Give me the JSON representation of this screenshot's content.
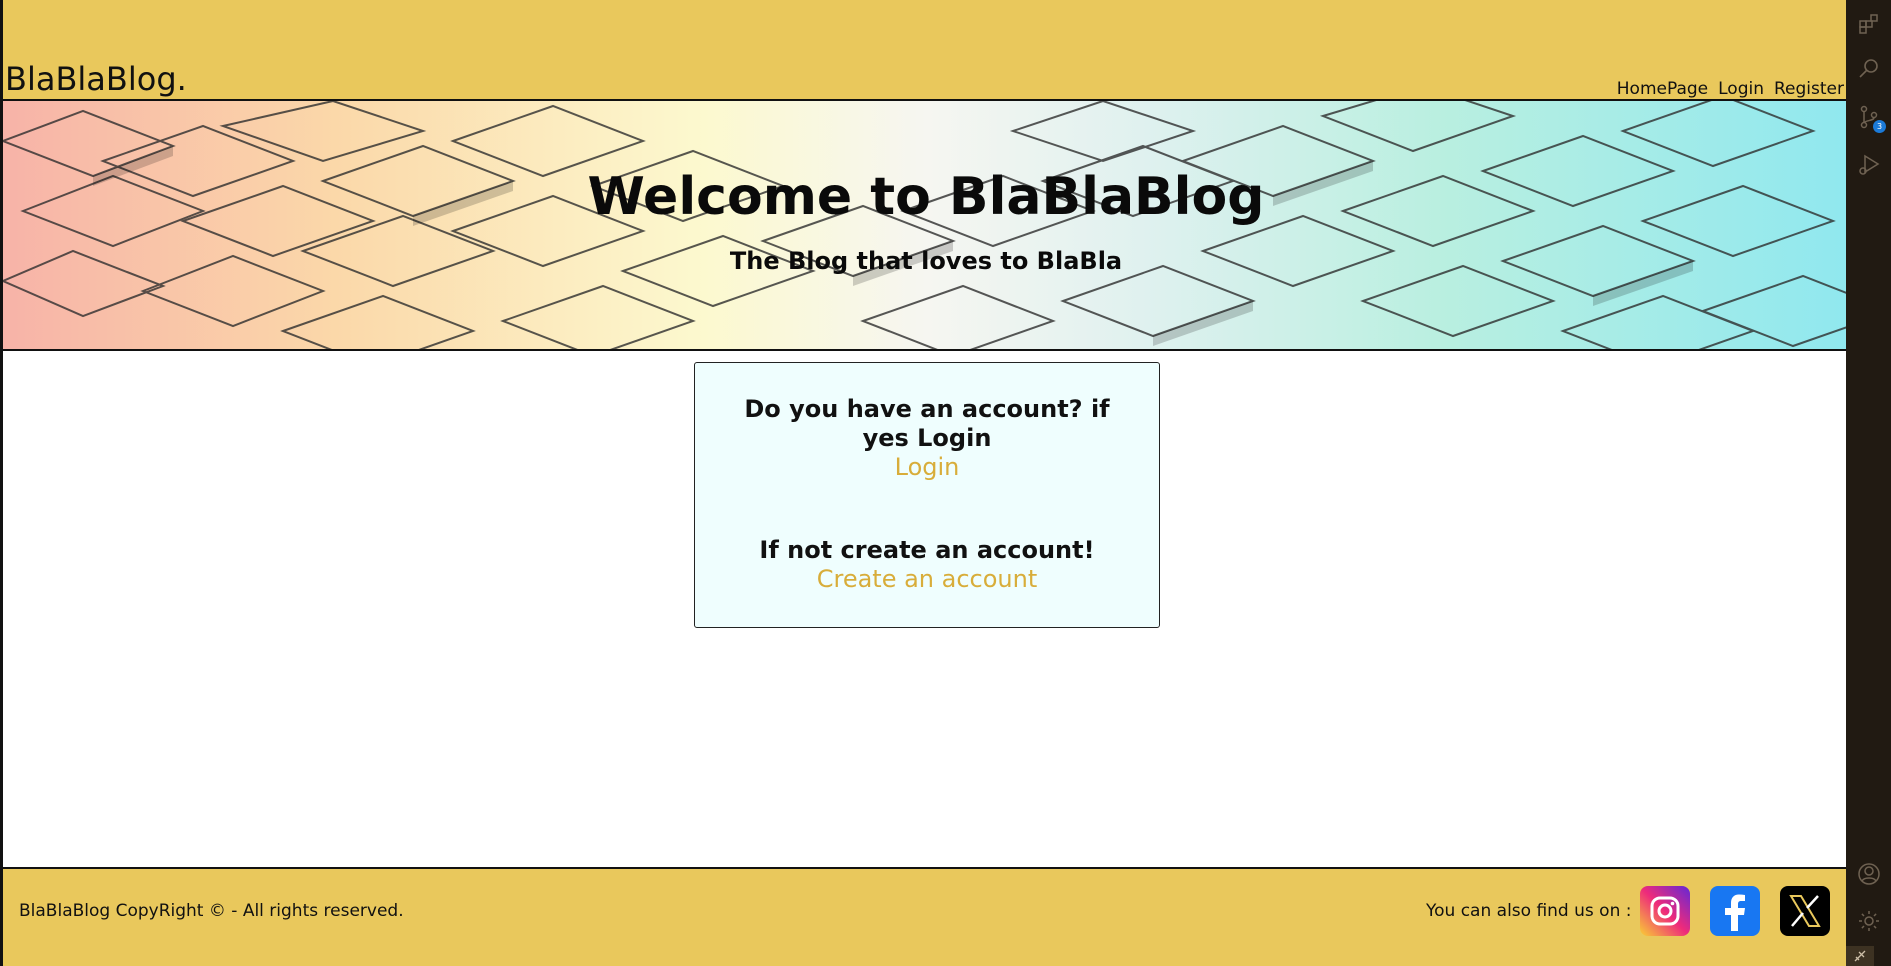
{
  "header": {
    "brand": "BlaBlaBlog.",
    "nav": [
      {
        "label": "HomePage"
      },
      {
        "label": "Login"
      },
      {
        "label": "Register"
      }
    ]
  },
  "hero": {
    "title": "Welcome to BlaBlaBlog",
    "subtitle": "The Blog that loves to BlaBla"
  },
  "card": {
    "login_question": "Do you have an account? if yes Login",
    "login_link": "Login",
    "register_question": "If not create an account!",
    "register_link": "Create an account"
  },
  "footer": {
    "copyright": "BlaBlaBlog CopyRight © - All rights reserved.",
    "find_us": "You can also find us on :",
    "social": [
      "instagram-icon",
      "facebook-icon",
      "x-icon"
    ]
  },
  "activity_bar": {
    "source_control_badge": "3",
    "icons": [
      "extensions-icon",
      "search-icon",
      "source-control-icon",
      "run-debug-icon",
      "account-icon",
      "settings-icon"
    ]
  },
  "colors": {
    "header_bg": "#e9c85c",
    "link": "#d8ad3a",
    "card_bg": "#effefe",
    "activity_bar_bg": "#211a12",
    "badge": "#1b7ad8"
  }
}
